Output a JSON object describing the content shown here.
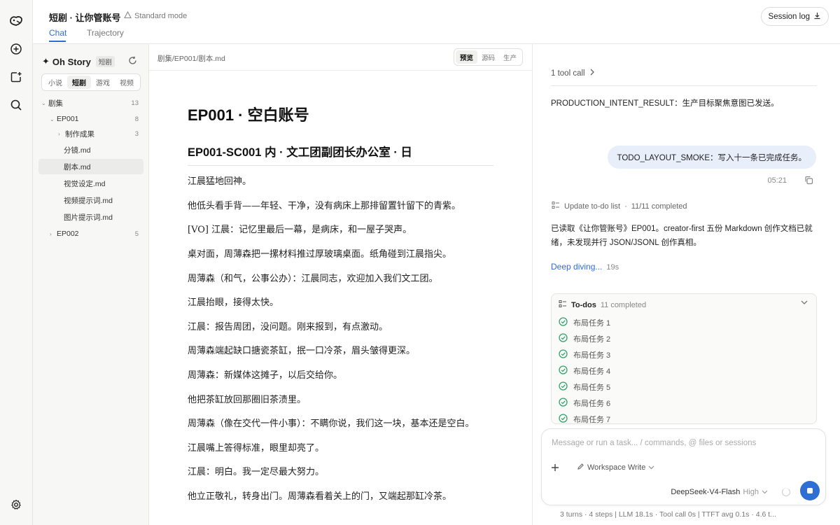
{
  "header": {
    "title": "短剧 · 让你管账号",
    "mode": "Standard mode",
    "tabs": [
      {
        "label": "Chat"
      },
      {
        "label": "Trajectory"
      }
    ],
    "session_log": "Session log"
  },
  "sidebar": {
    "brand": "Oh Story",
    "brand_badge": "短剧",
    "segments": [
      "小说",
      "短剧",
      "游戏",
      "视频"
    ],
    "active_segment": "短剧",
    "tree": [
      {
        "label": "剧集",
        "count": "13"
      },
      {
        "label": "EP001",
        "count": "8"
      },
      {
        "label": "制作成果",
        "count": "3"
      },
      {
        "label": "分镜.md"
      },
      {
        "label": "剧本.md"
      },
      {
        "label": "视觉设定.md"
      },
      {
        "label": "视频提示词.md"
      },
      {
        "label": "图片提示词.md"
      },
      {
        "label": "EP002",
        "count": "5"
      }
    ]
  },
  "document": {
    "path": "剧集/EP001/剧本.md",
    "views": [
      "预览",
      "源码",
      "生产"
    ],
    "active_view": "预览",
    "h1": "EP001 · 空白账号",
    "h2": "EP001-SC001 内 · 文工团副团长办公室 · 日",
    "paragraphs": [
      "江晨猛地回神。",
      "他低头看手背——年轻、干净，没有病床上那排留置针留下的青紫。",
      "[VO] 江晨：记忆里最后一幕，是病床，和一屋子哭声。",
      "桌对面，周薄森把一摞材料推过厚玻璃桌面。纸角碰到江晨指尖。",
      "周薄森（和气，公事公办）：江晨同志，欢迎加入我们文工团。",
      "江晨抬眼，接得太快。",
      "江晨：报告周团，没问题。刚来报到，有点激动。",
      "周薄森端起缺口搪瓷茶缸，抿一口冷茶，眉头皱得更深。",
      "周薄森：新媒体这摊子，以后交给你。",
      "他把茶缸放回那圈旧茶渍里。",
      "周薄森（像在交代一件小事）：不瞒你说，我们这一块，基本还是空白。",
      "江晨嘴上答得标准，眼里却亮了。",
      "江晨：明白。我一定尽最大努力。",
      "他立正敬礼，转身出门。周薄森看着关上的门，又端起那缸冷茶。"
    ]
  },
  "chat": {
    "tool_call": "1 tool call",
    "result": "PRODUCTION_INTENT_RESULT：生产目标聚焦意图已发送。",
    "user_message": "TODO_LAYOUT_SMOKE：写入十一条已完成任务。",
    "time": "05:21",
    "todo_update_label": "Update to-do list",
    "todo_update_status": "11/11 completed",
    "answer": "已读取《让你管账号》EP001。creator-first 五份 Markdown 创作文档已就绪，未发现并行 JSON/JSONL 创作真相。",
    "deep_diving": "Deep diving...",
    "deep_time": "19s",
    "todos_title": "To-dos",
    "todos_status": "11 completed",
    "todos": [
      "布局任务 1",
      "布局任务 2",
      "布局任务 3",
      "布局任务 4",
      "布局任务 5",
      "布局任务 6",
      "布局任务 7"
    ]
  },
  "composer": {
    "placeholder": "Message or run a task... / commands, @ files or sessions",
    "workspace": "Workspace Write",
    "model": "DeepSeek-V4-Flash",
    "level": "High",
    "stats": "3 turns · 4 steps  |  LLM 18.1s · Tool call 0s  |  TTFT avg 0.1s · 4.6 t..."
  },
  "colors": {
    "accent": "#2f6fd4",
    "user_bubble": "#e9eefb",
    "check": "#34a36b"
  }
}
